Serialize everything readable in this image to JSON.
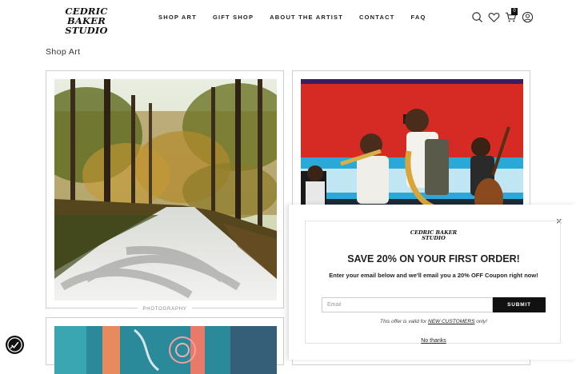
{
  "header": {
    "logo_line1": "CEDRIC BAKER",
    "logo_line2": "STUDIO",
    "nav": [
      "SHOP ART",
      "GIFT SHOP",
      "ABOUT THE ARTIST",
      "CONTACT",
      "FAQ"
    ],
    "cart_count": "0",
    "icons": [
      "search-icon",
      "heart-icon",
      "cart-icon",
      "account-icon"
    ]
  },
  "main": {
    "page_title": "Shop Art",
    "products": [
      {
        "category": "PHOTOGRAPHY"
      }
    ]
  },
  "popup": {
    "logo_line1": "CEDRIC BAKER",
    "logo_line2": "STUDIO",
    "headline": "SAVE 20% ON YOUR FIRST ORDER!",
    "body": "Enter your email below and we'll email you a 20% OFF Coupon right now!",
    "email_placeholder": "Email",
    "submit_label": "SUBMIT",
    "offer_prefix": "This offer is valid for ",
    "offer_link": "NEW CUSTOMERS",
    "offer_suffix": " only!",
    "no_thanks": "No thanks",
    "close_label": "×"
  },
  "colors": {
    "accent": "#111111",
    "border": "#cfcfcf"
  }
}
